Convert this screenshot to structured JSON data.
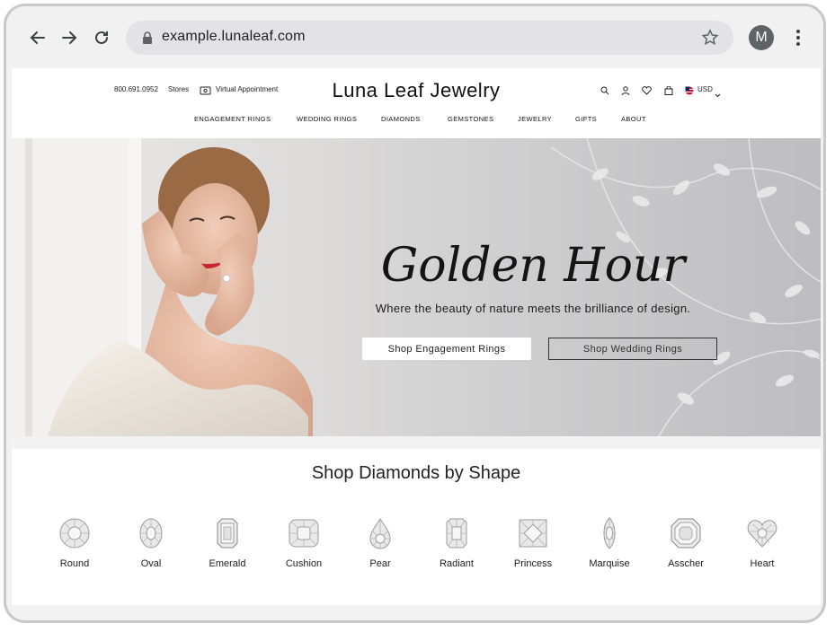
{
  "browser": {
    "url": "example.lunaleaf.com",
    "profile_initial": "M"
  },
  "utility": {
    "phone": "800.691.0952",
    "stores": "Stores",
    "virtual": "Virtual Appointment",
    "currency": "USD"
  },
  "brand": {
    "name": "Luna Leaf Jewelry"
  },
  "nav": {
    "items": [
      "ENGAGEMENT RINGS",
      "WEDDING RINGS",
      "DIAMONDS",
      "GEMSTONES",
      "JEWELRY",
      "GIFTS",
      "ABOUT"
    ]
  },
  "hero": {
    "title": "Golden Hour",
    "subtitle": "Where the beauty of nature meets the brilliance of design.",
    "primary_cta": "Shop Engagement Rings",
    "secondary_cta": "Shop Wedding Rings"
  },
  "shapes": {
    "title": "Shop Diamonds by Shape",
    "items": [
      "Round",
      "Oval",
      "Emerald",
      "Cushion",
      "Pear",
      "Radiant",
      "Princess",
      "Marquise",
      "Asscher",
      "Heart"
    ]
  },
  "colors": {
    "chrome": "#f1f1f2",
    "urlbar": "#e3e3e5",
    "hero_bg": "#d6d5d4",
    "text": "#111111"
  }
}
